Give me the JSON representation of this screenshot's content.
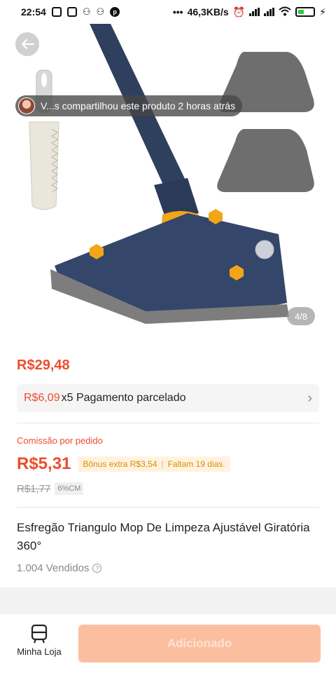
{
  "status_bar": {
    "time": "22:54",
    "network_speed": "46,3KB/s",
    "dots": "•••",
    "battery_level": 0.35
  },
  "hero": {
    "share_text": "V...s compartilhou este produto 2 horas atrás",
    "page_indicator": "4/8",
    "back_icon": "arrow-left-icon"
  },
  "price": {
    "main": "R$29,48",
    "installment_amount": "R$6,09",
    "installment_text": "x5 Pagamento parcelado"
  },
  "commission": {
    "label": "Comissão por pedido",
    "value": "R$5,31",
    "bonus": "Bônus extra R$3,54",
    "days_left": "Faltam 19 dias.",
    "old_value": "R$1,77",
    "cm_badge": "6%CM"
  },
  "product": {
    "title": "Esfregão Triangulo Mop De Limpeza Ajustável Giratória 360°",
    "sold": "1.004 Vendidos"
  },
  "bottom_bar": {
    "store_label": "Minha Loja",
    "add_button": "Adicionado"
  },
  "colors": {
    "accent": "#ee4d2d",
    "add_button_bg": "#fbbf9f",
    "bonus_text": "#e08a00"
  }
}
